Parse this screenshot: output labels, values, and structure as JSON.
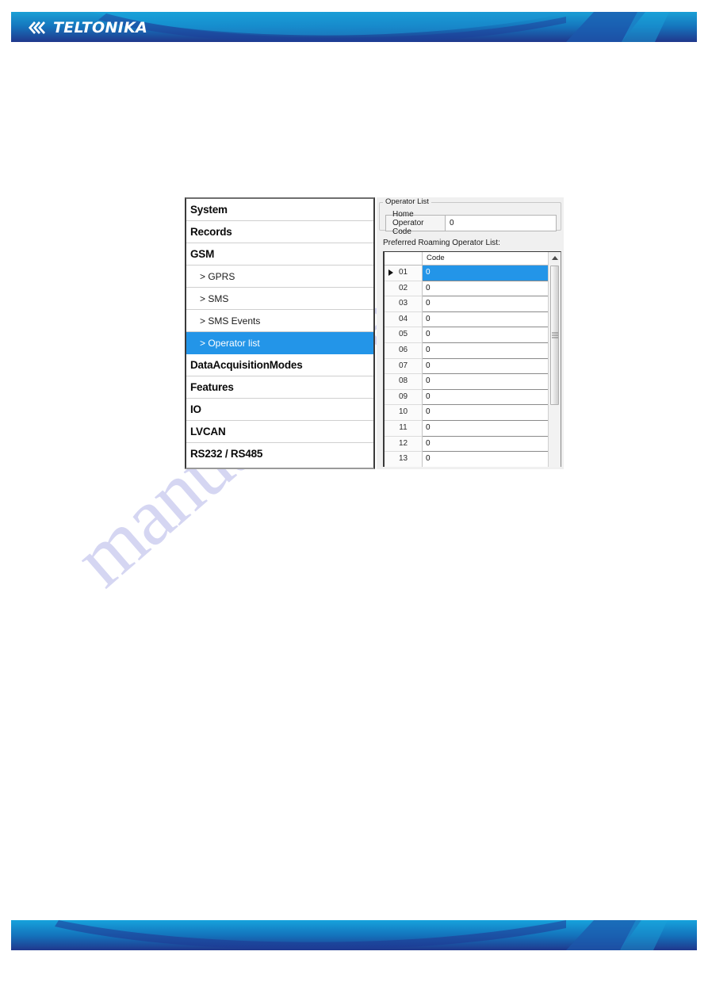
{
  "brand": {
    "name": "TELTONIKA",
    "band_color_light": "#1b9fd8",
    "band_color_dark": "#1b3f8f"
  },
  "watermark": {
    "text": "manualshive.com",
    "color": "#c7c9ee"
  },
  "nav": {
    "items": [
      {
        "label": "System",
        "level": "top",
        "selected": false
      },
      {
        "label": "Records",
        "level": "top",
        "selected": false
      },
      {
        "label": "GSM",
        "level": "top",
        "selected": false
      },
      {
        "label": "> GPRS",
        "level": "sub",
        "selected": false
      },
      {
        "label": "> SMS",
        "level": "sub",
        "selected": false
      },
      {
        "label": "> SMS Events",
        "level": "sub",
        "selected": false
      },
      {
        "label": "> Operator list",
        "level": "sub",
        "selected": true
      },
      {
        "label": "DataAcquisitionModes",
        "level": "top",
        "selected": false
      },
      {
        "label": "Features",
        "level": "top",
        "selected": false
      },
      {
        "label": "IO",
        "level": "top",
        "selected": false
      },
      {
        "label": "LVCAN",
        "level": "top",
        "selected": false
      },
      {
        "label": "RS232 / RS485",
        "level": "top",
        "selected": false
      }
    ],
    "selected_color": "#2395e8"
  },
  "panel": {
    "group_title": "Operator List",
    "home_operator": {
      "label": "Home Operator Code",
      "value": "0",
      "placeholder": "0"
    },
    "list_caption": "Preferred Roaming Operator List:",
    "grid": {
      "columns": [
        "",
        "Code"
      ],
      "selected_row": "01",
      "rows": [
        {
          "index": "01",
          "code": "0"
        },
        {
          "index": "02",
          "code": "0"
        },
        {
          "index": "03",
          "code": "0"
        },
        {
          "index": "04",
          "code": "0"
        },
        {
          "index": "05",
          "code": "0"
        },
        {
          "index": "06",
          "code": "0"
        },
        {
          "index": "07",
          "code": "0"
        },
        {
          "index": "08",
          "code": "0"
        },
        {
          "index": "09",
          "code": "0"
        },
        {
          "index": "10",
          "code": "0"
        },
        {
          "index": "11",
          "code": "0"
        },
        {
          "index": "12",
          "code": "0"
        },
        {
          "index": "13",
          "code": "0"
        }
      ]
    }
  }
}
